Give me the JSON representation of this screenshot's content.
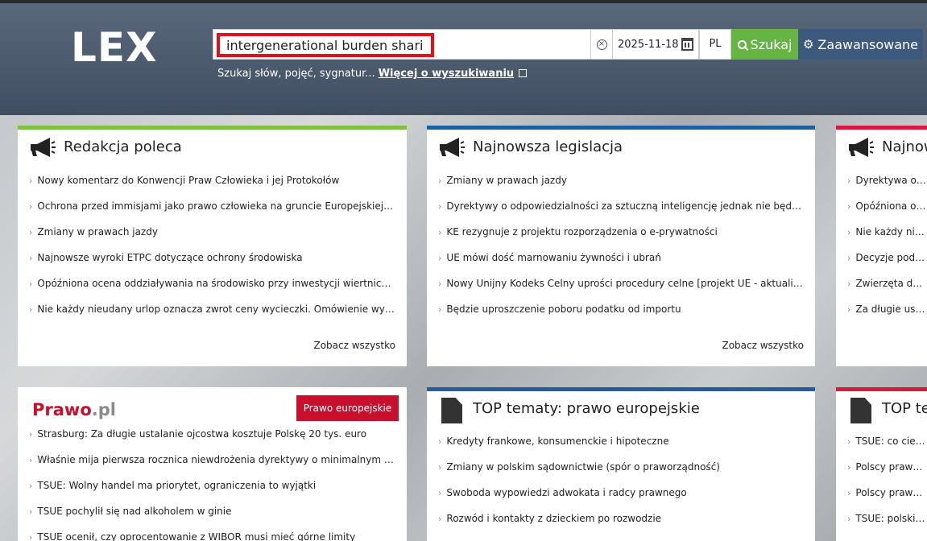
{
  "header": {
    "logo": "LEX",
    "search_value": "intergenerational burden sharing",
    "date": "2025-11-18",
    "lang": "PL",
    "search_button": "Szukaj",
    "advanced_button": "Zaawansowane",
    "hint_text": "Szukaj słów, pojęć, sygnatur...",
    "hint_link": "Więcej o wyszukiwaniu"
  },
  "colors": {
    "search_highlight": "#e3101b",
    "search_green": "#66b444",
    "advanced_blue": "#3d5a7e",
    "accent_green": "#7cc242",
    "accent_blue": "#1f5f9e",
    "accent_red": "#d7193f"
  },
  "panels": {
    "redakcja": {
      "title": "Redakcja poleca",
      "icon": "megaphone-icon",
      "items": [
        "Nowy komentarz do Konwencji Praw Człowieka i jej Protokołów",
        "Ochrona przed immisjami jako prawo człowieka na gruncie Europejskiej K...",
        "Zmiany w prawach jazdy",
        "Najnowsze wyroki ETPC dotyczące ochrony środowiska",
        "Opóźniona ocena oddziaływania na środowisko przy inwestycji wiertniczej...",
        "Nie każdy nieudany urlop oznacza zwrot ceny wycieczki. Omówienie wyro..."
      ],
      "more": "Zobacz wszystko"
    },
    "legislacja": {
      "title": "Najnowsza legislacja",
      "icon": "megaphone-icon",
      "items": [
        "Zmiany w prawach jazdy",
        "Dyrektywy o odpowiedzialności za sztuczną inteligencję jednak nie będzie",
        "KE rezygnuje z projektu rozporządzenia o e-prywatności",
        "UE mówi dość marnowaniu żywności i ubrań",
        "Nowy Unijny Kodeks Celny uprości procedury celne [projekt UE - aktualiza...",
        "Będzie uproszczenie poboru podatku od importu"
      ],
      "more": "Zobacz wszystko"
    },
    "third": {
      "title": "Najnow",
      "icon": "megaphone-icon",
      "items": [
        "Dyrektywa o m",
        "Opóźniona oce",
        "Nie każdy nieuc",
        "Decyzje podatk",
        "Zwierzęta dom",
        "Za długie ustal"
      ]
    },
    "prawo": {
      "logo_a": "Prawo",
      "logo_b": ".pl",
      "button": "Prawo europejskie",
      "items": [
        "Strasburg: Za długie ustalanie ojcostwa kosztuje Polskę 20 tys. euro",
        "Właśnie mija pierwsza rocznica niewdrożenia dyrektywy o minimalnym wy...",
        "TSUE: Wolny handel ma priorytet, ograniczenia to wyjątki",
        "TSUE pochylił się nad alkoholem w ginie",
        "TSUE ocenił, czy oprocentowanie z WIBOR musi mieć górne limity"
      ]
    },
    "top": {
      "title": "TOP tematy: prawo europejskie",
      "icon": "document-icon",
      "items": [
        "Kredyty frankowe, konsumenckie i hipoteczne",
        "Zmiany w polskim sądownictwie (spór o praworządność)",
        "Swoboda wypowiedzi adwokata i radcy prawnego",
        "Rozwód i kontakty z dzieckiem po rozwodzie"
      ]
    },
    "top2": {
      "title": "TOP te",
      "icon": "document-icon",
      "items": [
        "TSUE: co ciekaw",
        "Polscy prawnicy",
        "Polscy prawnicy",
        "TSUE: polskie s"
      ]
    }
  }
}
